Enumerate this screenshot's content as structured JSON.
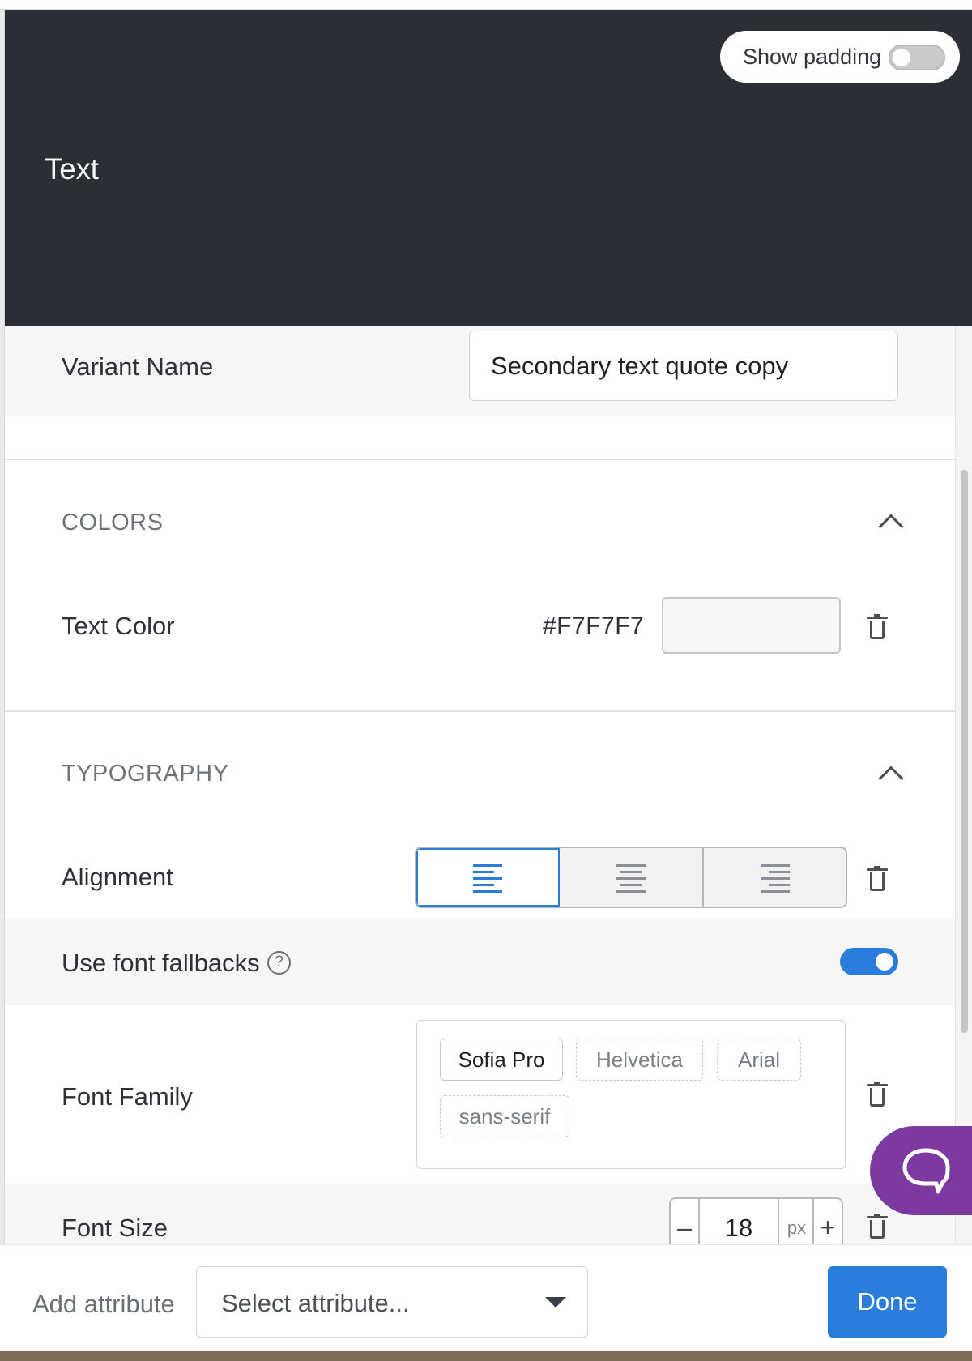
{
  "preview": {
    "text": "Text",
    "show_padding_label": "Show padding",
    "show_padding_on": false,
    "background": "#2a2f36"
  },
  "variant": {
    "label": "Variant Name",
    "value": "Secondary text quote copy"
  },
  "colors": {
    "title": "COLORS",
    "text_color_label": "Text Color",
    "text_color_value": "#F7F7F7"
  },
  "typography": {
    "title": "TYPOGRAPHY",
    "alignment_label": "Alignment",
    "alignment_options": [
      "left",
      "center",
      "right"
    ],
    "alignment_selected": "left",
    "fallbacks_label": "Use font fallbacks",
    "fallbacks_on": true,
    "font_family_label": "Font Family",
    "fonts": [
      "Sofia Pro",
      "Helvetica",
      "Arial",
      "sans-serif"
    ],
    "font_size_label": "Font Size",
    "font_size_value": "18",
    "font_size_unit": "px"
  },
  "footer": {
    "add_attribute_label": "Add attribute",
    "select_placeholder": "Select attribute...",
    "done_label": "Done"
  },
  "colors_meta": {
    "accent": "#2a7ddb",
    "chat_button": "#7c3aa0"
  }
}
